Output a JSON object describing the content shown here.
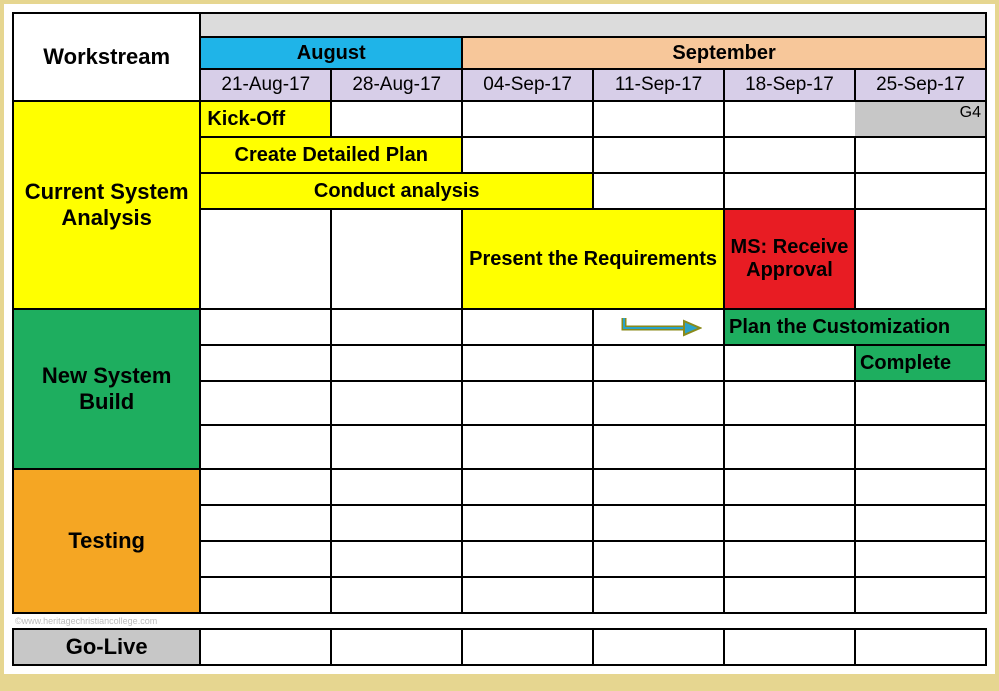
{
  "header": {
    "workstream": "Workstream",
    "months": {
      "aug": "August",
      "sep": "September"
    },
    "dates": [
      "21-Aug-17",
      "28-Aug-17",
      "04-Sep-17",
      "11-Sep-17",
      "18-Sep-17",
      "25-Sep-17"
    ]
  },
  "corner_badge": "G4",
  "workstreams": {
    "current": "Current System Analysis",
    "newbuild": "New System Build",
    "testing": "Testing",
    "golive": "Go-Live"
  },
  "tasks": {
    "kickoff": "Kick-Off",
    "create_plan": "Create Detailed Plan",
    "conduct_analysis": "Conduct analysis",
    "present_req": "Present the Requirements",
    "ms_approval": "MS: Receive Approval",
    "plan_custom": "Plan the Customization",
    "complete": "Complete "
  },
  "watermark": "©www.heritagechristiancollege.com",
  "chart_data": {
    "type": "table",
    "columns": [
      "21-Aug-17",
      "28-Aug-17",
      "04-Sep-17",
      "11-Sep-17",
      "18-Sep-17",
      "25-Sep-17"
    ],
    "workstreams": [
      {
        "name": "Current System Analysis",
        "color": "#ffff00",
        "tasks": [
          {
            "name": "Kick-Off",
            "start": "21-Aug-17",
            "end": "21-Aug-17",
            "color": "#ffff00"
          },
          {
            "name": "Create Detailed Plan",
            "start": "21-Aug-17",
            "end": "28-Aug-17",
            "color": "#ffff00"
          },
          {
            "name": "Conduct analysis",
            "start": "21-Aug-17",
            "end": "04-Sep-17",
            "color": "#ffff00"
          },
          {
            "name": "Present the Requirements",
            "start": "04-Sep-17",
            "end": "11-Sep-17",
            "color": "#ffff00"
          },
          {
            "name": "MS: Receive Approval",
            "start": "18-Sep-17",
            "end": "18-Sep-17",
            "color": "#e81c23",
            "milestone": true
          }
        ]
      },
      {
        "name": "New System Build",
        "color": "#1eae5f",
        "tasks": [
          {
            "name": "Plan the Customization",
            "start": "18-Sep-17",
            "end": "25-Sep-17",
            "color": "#1eae5f"
          },
          {
            "name": "Complete",
            "start": "25-Sep-17",
            "end": "25-Sep-17",
            "color": "#1eae5f",
            "truncated_right": true
          }
        ]
      },
      {
        "name": "Testing",
        "color": "#f5a623",
        "tasks": []
      },
      {
        "name": "Go-Live",
        "color": "#c7c7c7",
        "tasks": []
      }
    ],
    "corner_badge": "G4"
  }
}
